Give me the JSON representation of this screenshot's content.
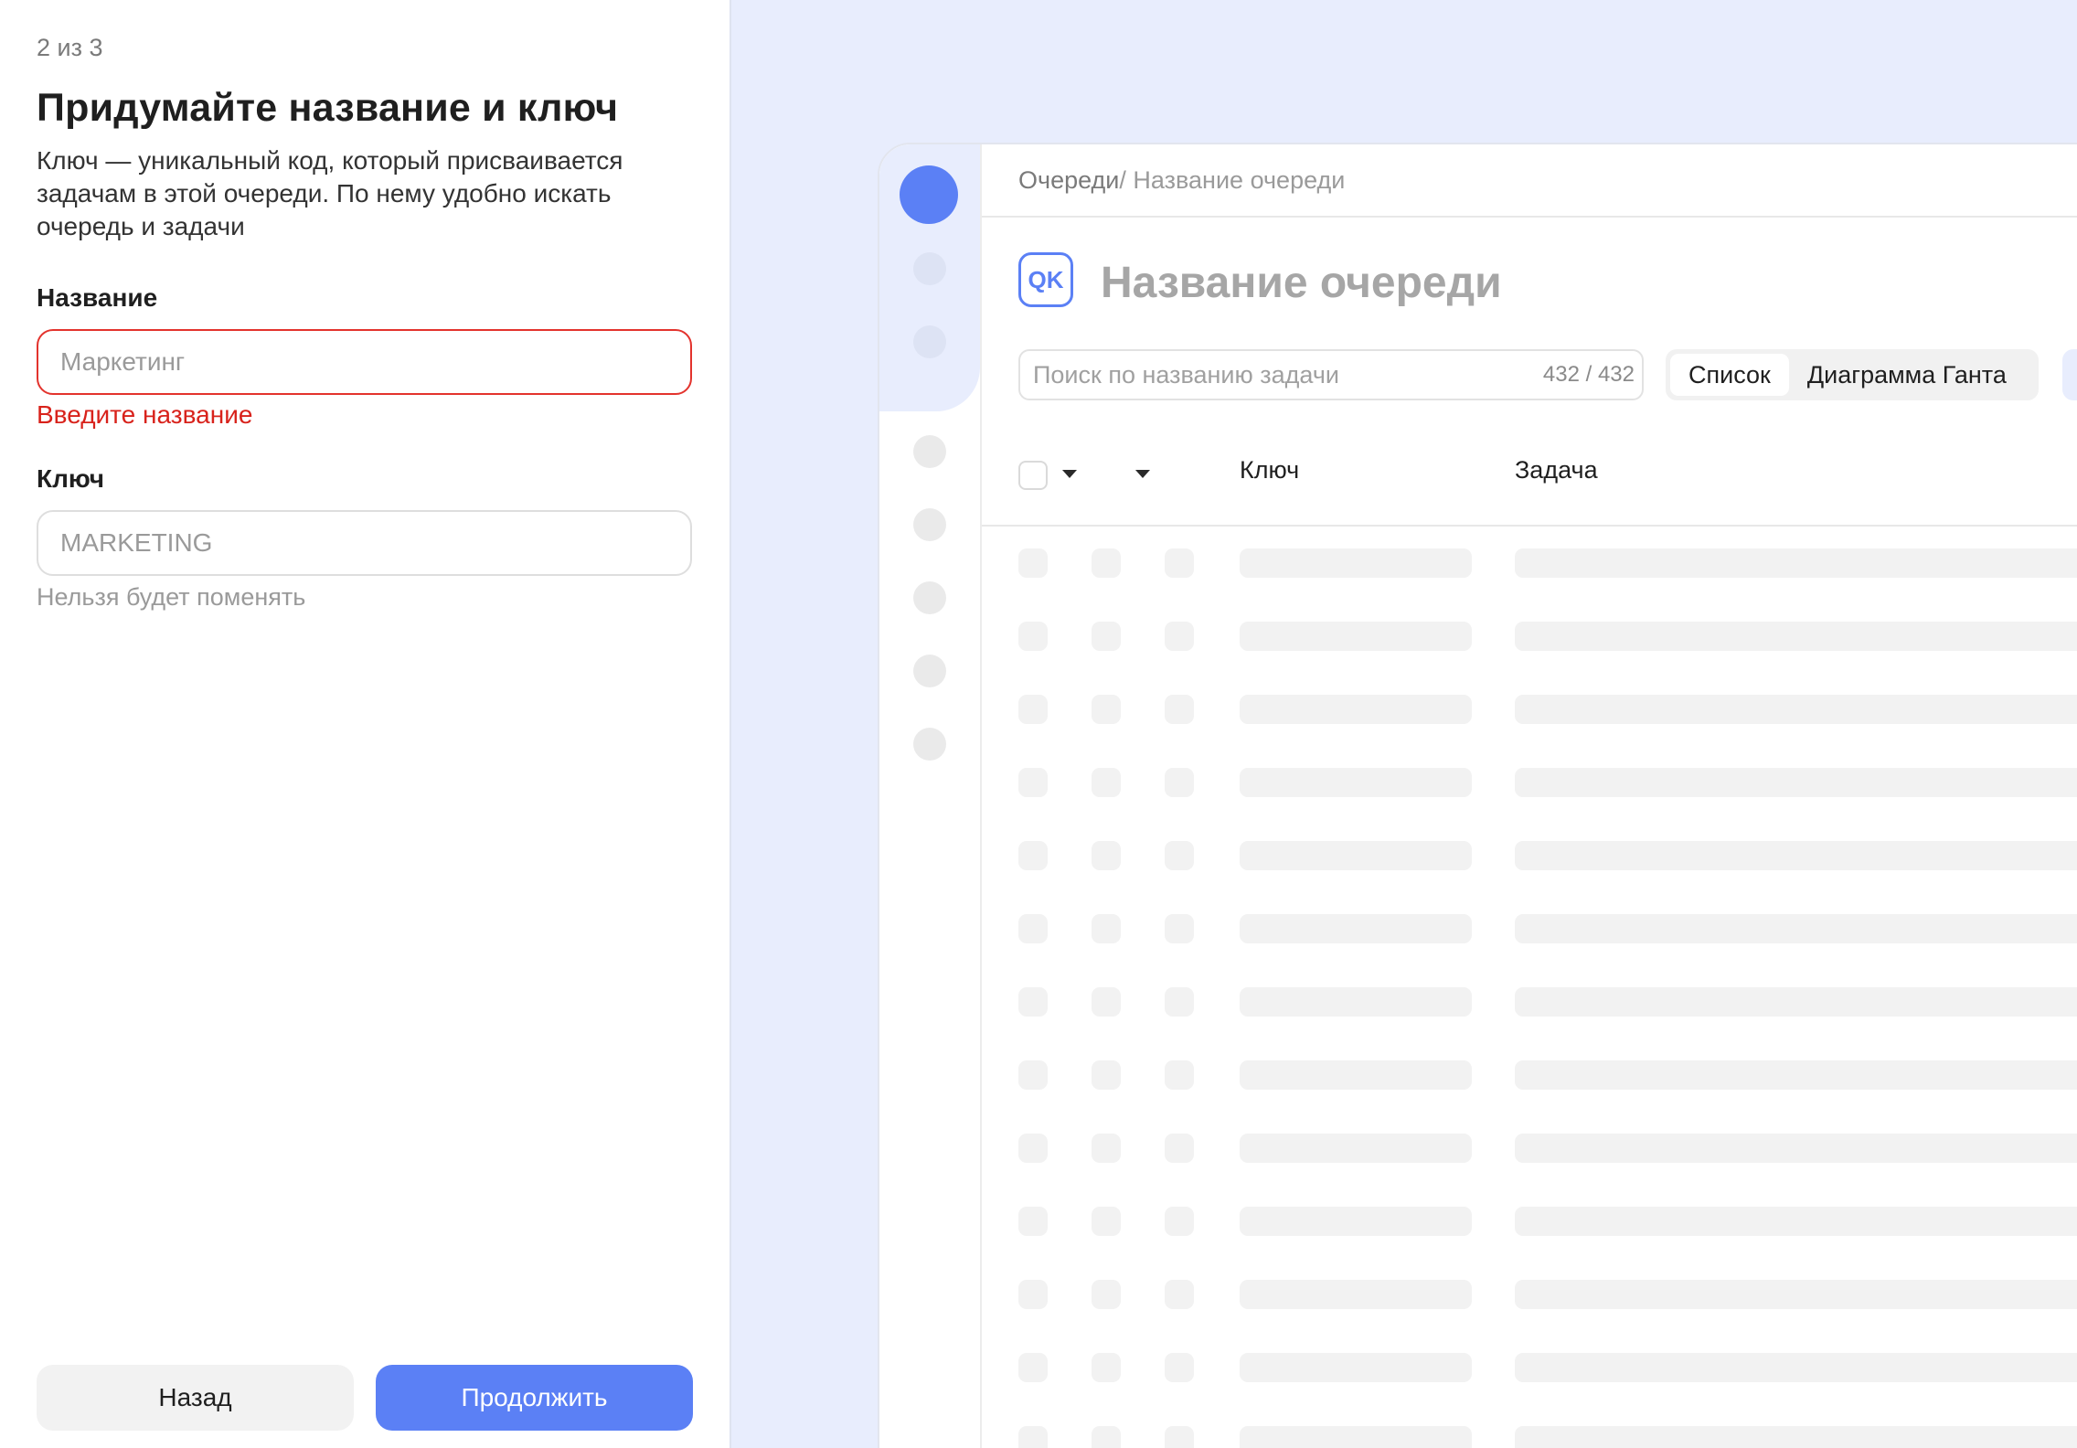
{
  "form": {
    "step": "2 из 3",
    "title": "Придумайте название и ключ",
    "description": "Ключ — уникальный код, который присваивается задачам в этой очереди. По нему удобно искать очередь и задачи",
    "name_label": "Название",
    "name_placeholder": "Маркетинг",
    "name_error": "Введите название",
    "key_label": "Ключ",
    "key_placeholder": "MARKETING",
    "key_hint": "Нельзя будет поменять",
    "back_label": "Назад",
    "continue_label": "Продолжить",
    "colors": {
      "accent": "#5b80f5",
      "error": "#d8221b"
    }
  },
  "preview": {
    "breadcrumb_root": "Очереди",
    "breadcrumb_separator": "/",
    "breadcrumb_current": "Название очереди",
    "queue_badge": "QK",
    "queue_title": "Название очереди",
    "search_placeholder": "Поиск по названию задачи",
    "search_count": "432 / 432",
    "tabs": [
      {
        "label": "Список",
        "active": true
      },
      {
        "label": "Диаграмма Ганта",
        "active": false
      }
    ],
    "columns": {
      "key": "Ключ",
      "task": "Задача"
    },
    "skeleton_rows": 13,
    "background": "#e8edfd"
  }
}
